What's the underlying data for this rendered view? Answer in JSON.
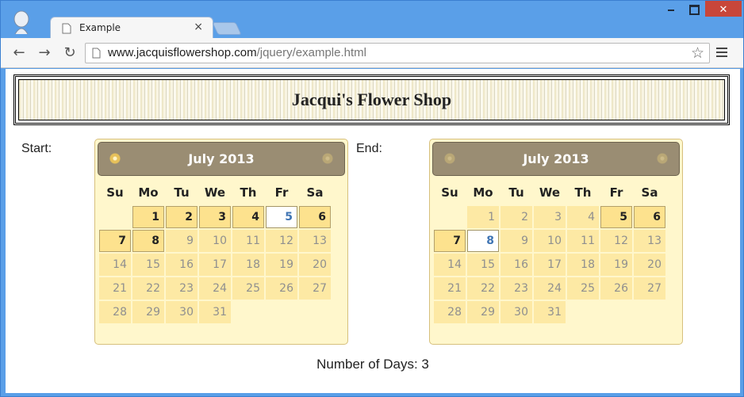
{
  "browser": {
    "tab_title": "Example",
    "tab_close": "×",
    "url_host": "www.jacquisflowershop.com",
    "url_path": "/jquery/example.html",
    "close_glyph": "✕"
  },
  "page": {
    "banner_title": "Jacqui's Flower Shop",
    "start_label": "Start:",
    "end_label": "End:",
    "days_count": "Number of Days: 3"
  },
  "weekdays": [
    "Su",
    "Mo",
    "Tu",
    "We",
    "Th",
    "Fr",
    "Sa"
  ],
  "start_calendar": {
    "title": "July 2013",
    "rows": [
      [
        [
          "",
          " "
        ],
        [
          "1",
          "active"
        ],
        [
          "2",
          "active"
        ],
        [
          "3",
          "active"
        ],
        [
          "4",
          "active"
        ],
        [
          "5",
          "sel"
        ],
        [
          "6",
          "active"
        ]
      ],
      [
        [
          "7",
          "active"
        ],
        [
          "8",
          "active"
        ],
        [
          "9",
          "dim"
        ],
        [
          "10",
          "dim"
        ],
        [
          "11",
          "dim"
        ],
        [
          "12",
          "dim"
        ],
        [
          "13",
          "dim"
        ]
      ],
      [
        [
          "14",
          "dim"
        ],
        [
          "15",
          "dim"
        ],
        [
          "16",
          "dim"
        ],
        [
          "17",
          "dim"
        ],
        [
          "18",
          "dim"
        ],
        [
          "19",
          "dim"
        ],
        [
          "20",
          "dim"
        ]
      ],
      [
        [
          "21",
          "dim"
        ],
        [
          "22",
          "dim"
        ],
        [
          "23",
          "dim"
        ],
        [
          "24",
          "dim"
        ],
        [
          "25",
          "dim"
        ],
        [
          "26",
          "dim"
        ],
        [
          "27",
          "dim"
        ]
      ],
      [
        [
          "28",
          "dim"
        ],
        [
          "29",
          "dim"
        ],
        [
          "30",
          "dim"
        ],
        [
          "31",
          "dim"
        ],
        [
          "",
          ""
        ],
        [
          "",
          ""
        ],
        [
          "",
          ""
        ]
      ]
    ]
  },
  "end_calendar": {
    "title": "July 2013",
    "rows": [
      [
        [
          "",
          " "
        ],
        [
          "1",
          "dim"
        ],
        [
          "2",
          "dim"
        ],
        [
          "3",
          "dim"
        ],
        [
          "4",
          "dim"
        ],
        [
          "5",
          "active"
        ],
        [
          "6",
          "active"
        ]
      ],
      [
        [
          "7",
          "active"
        ],
        [
          "8",
          "sel"
        ],
        [
          "9",
          "dim"
        ],
        [
          "10",
          "dim"
        ],
        [
          "11",
          "dim"
        ],
        [
          "12",
          "dim"
        ],
        [
          "13",
          "dim"
        ]
      ],
      [
        [
          "14",
          "dim"
        ],
        [
          "15",
          "dim"
        ],
        [
          "16",
          "dim"
        ],
        [
          "17",
          "dim"
        ],
        [
          "18",
          "dim"
        ],
        [
          "19",
          "dim"
        ],
        [
          "20",
          "dim"
        ]
      ],
      [
        [
          "21",
          "dim"
        ],
        [
          "22",
          "dim"
        ],
        [
          "23",
          "dim"
        ],
        [
          "24",
          "dim"
        ],
        [
          "25",
          "dim"
        ],
        [
          "26",
          "dim"
        ],
        [
          "27",
          "dim"
        ]
      ],
      [
        [
          "28",
          "dim"
        ],
        [
          "29",
          "dim"
        ],
        [
          "30",
          "dim"
        ],
        [
          "31",
          "dim"
        ],
        [
          "",
          ""
        ],
        [
          "",
          ""
        ],
        [
          "",
          ""
        ]
      ]
    ]
  }
}
